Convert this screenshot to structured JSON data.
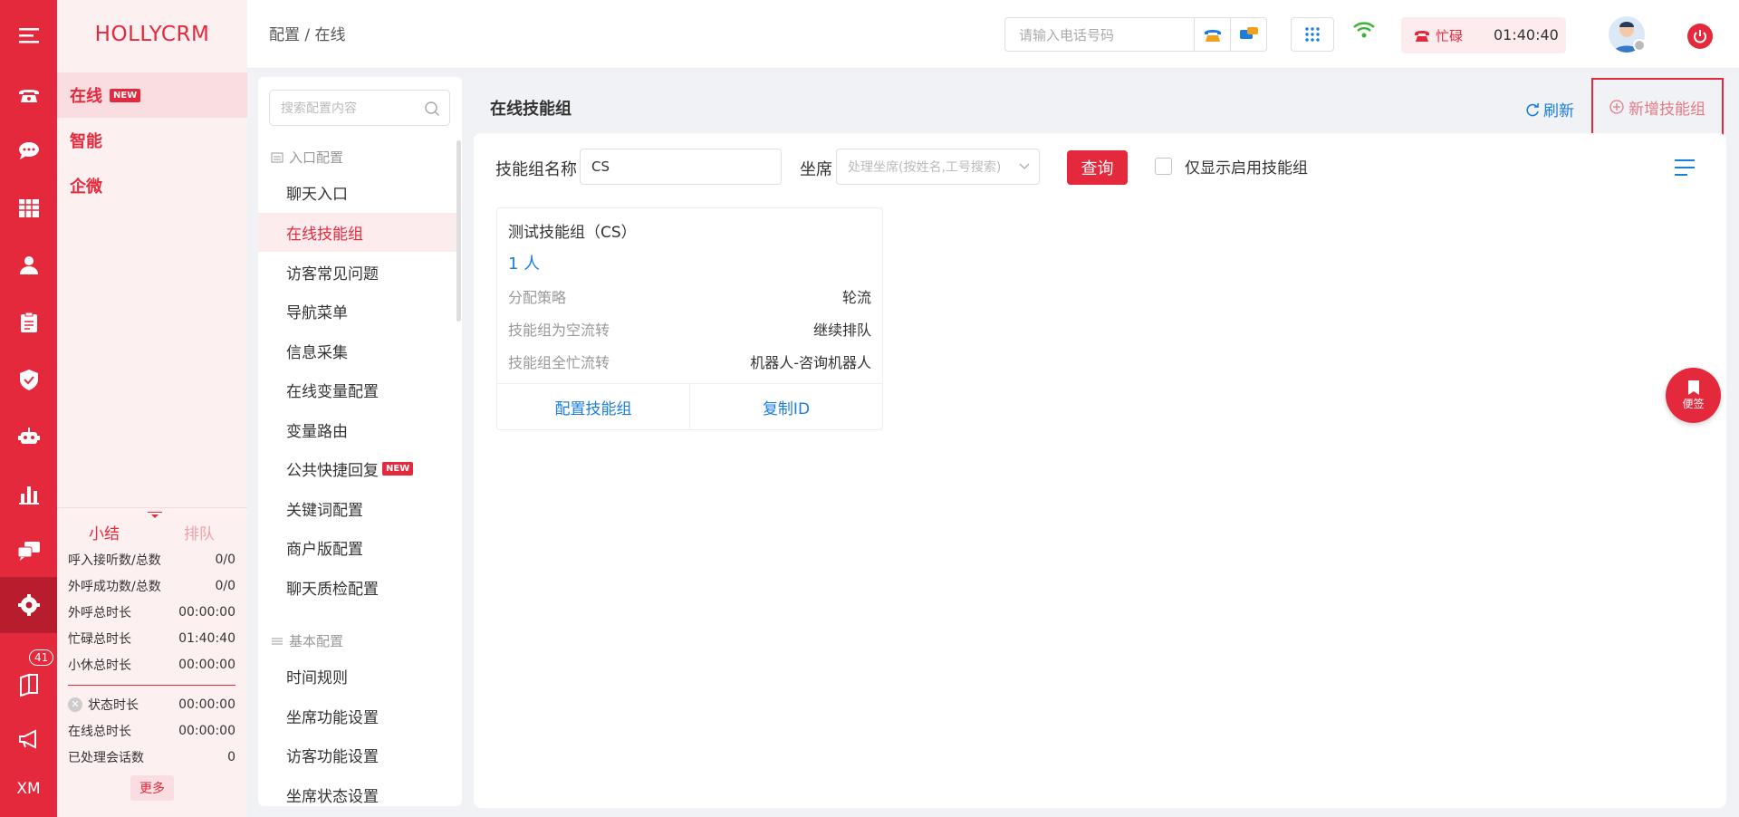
{
  "app": {
    "logo": "HOLLYCRM"
  },
  "left_nav": {
    "items": [
      {
        "label": "在线",
        "badge": "NEW"
      },
      {
        "label": "智能"
      },
      {
        "label": "企微"
      }
    ]
  },
  "rail": {
    "notification_count": "41",
    "bottom_text": "XM"
  },
  "stats": {
    "tab_summary": "小结",
    "tab_queue": "排队",
    "rows": [
      {
        "label": "呼入接听数/总数",
        "value": "0/0"
      },
      {
        "label": "外呼成功数/总数",
        "value": "0/0"
      },
      {
        "label": "外呼总时长",
        "value": "00:00:00"
      },
      {
        "label": "忙碌总时长",
        "value": "01:40:40"
      },
      {
        "label": "小休总时长",
        "value": "00:00:00"
      }
    ],
    "rows2": [
      {
        "label": "状态时长",
        "value": "00:00:00"
      },
      {
        "label": "在线总时长",
        "value": "00:00:00"
      },
      {
        "label": "已处理会话数",
        "value": "0"
      }
    ],
    "more": "更多"
  },
  "topbar": {
    "breadcrumb": "配置  /  在线",
    "phone_placeholder": "请输入电话号码",
    "status_label": "忙碌",
    "status_time": "01:40:40"
  },
  "menu": {
    "search_placeholder": "搜索配置内容",
    "section1": "入口配置",
    "items1": [
      {
        "label": "聊天入口"
      },
      {
        "label": "在线技能组",
        "active": true
      },
      {
        "label": "访客常见问题"
      },
      {
        "label": "导航菜单"
      },
      {
        "label": "信息采集"
      },
      {
        "label": "在线变量配置"
      },
      {
        "label": "变量路由"
      },
      {
        "label": "公共快捷回复",
        "badge": "NEW"
      },
      {
        "label": "关键词配置"
      },
      {
        "label": "商户版配置"
      },
      {
        "label": "聊天质检配置"
      }
    ],
    "section2": "基本配置",
    "items2": [
      {
        "label": "时间规则"
      },
      {
        "label": "坐席功能设置"
      },
      {
        "label": "访客功能设置"
      },
      {
        "label": "坐席状态设置"
      }
    ]
  },
  "content": {
    "title": "在线技能组",
    "refresh": "刷新",
    "add": "新增技能组",
    "filter": {
      "name_label": "技能组名称",
      "name_value": "CS",
      "agent_label": "坐席",
      "agent_placeholder": "处理坐席(按姓名,工号搜索)",
      "query": "查询",
      "only_enabled": "仅显示启用技能组"
    },
    "card": {
      "title": "测试技能组（CS）",
      "count": "1 人",
      "rows": [
        {
          "k": "分配策略",
          "v": "轮流"
        },
        {
          "k": "技能组为空流转",
          "v": "继续排队"
        },
        {
          "k": "技能组全忙流转",
          "v": "机器人-咨询机器人"
        }
      ],
      "config": "配置技能组",
      "copy": "复制ID"
    },
    "note": "便签"
  }
}
